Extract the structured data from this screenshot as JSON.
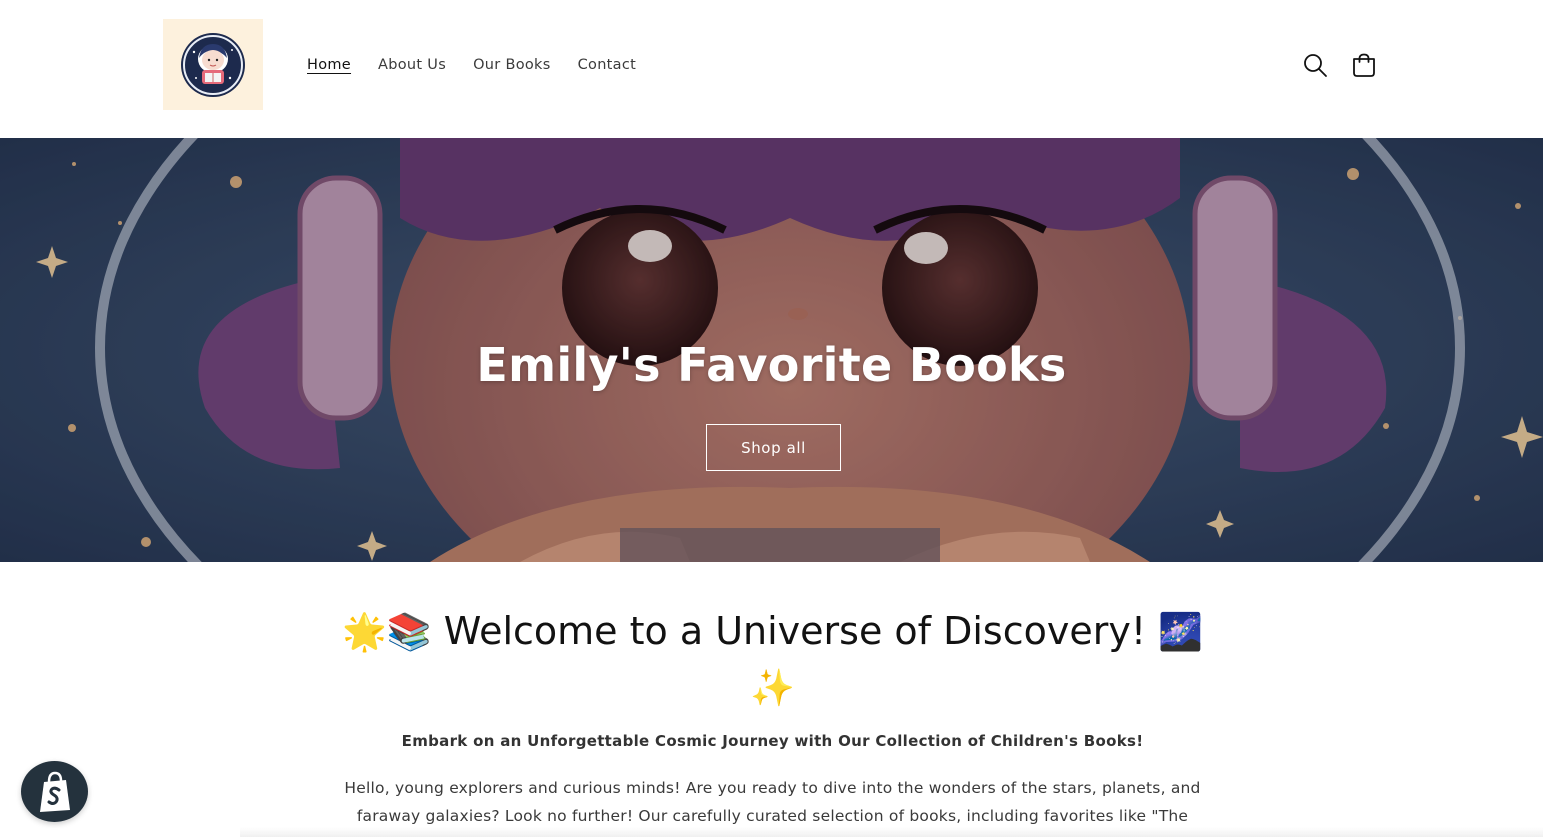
{
  "header": {
    "logo_alt": "Emily's Favorite Books logo",
    "nav": [
      {
        "label": "Home",
        "active": true
      },
      {
        "label": "About Us",
        "active": false
      },
      {
        "label": "Our Books",
        "active": false
      },
      {
        "label": "Contact",
        "active": false
      }
    ],
    "icons": {
      "search": "search-icon",
      "cart": "cart-icon"
    }
  },
  "hero": {
    "title": "Emily's Favorite Books",
    "button_label": "Shop all"
  },
  "content": {
    "welcome_emoji_left": "🌟📚",
    "welcome_text": "Welcome to a Universe of Discovery!",
    "welcome_emoji_right": "🌌",
    "welcome_emoji_sparkle": "✨",
    "subheading": "Embark on an Unforgettable Cosmic Journey with Our Collection of Children's Books!",
    "body_line_1": "Hello, young explorers and curious minds! Are you ready to dive into the wonders of the stars, planets, and",
    "body_line_2": "faraway galaxies? Look no further! Our carefully curated selection of books, including favorites like \"The"
  },
  "badge": {
    "icon": "shopify-bag-icon"
  },
  "colors": {
    "logo_bg": "#fdf1dd",
    "hero_space": "#34496a",
    "text": "#121212",
    "badge_bg": "#24323d"
  }
}
